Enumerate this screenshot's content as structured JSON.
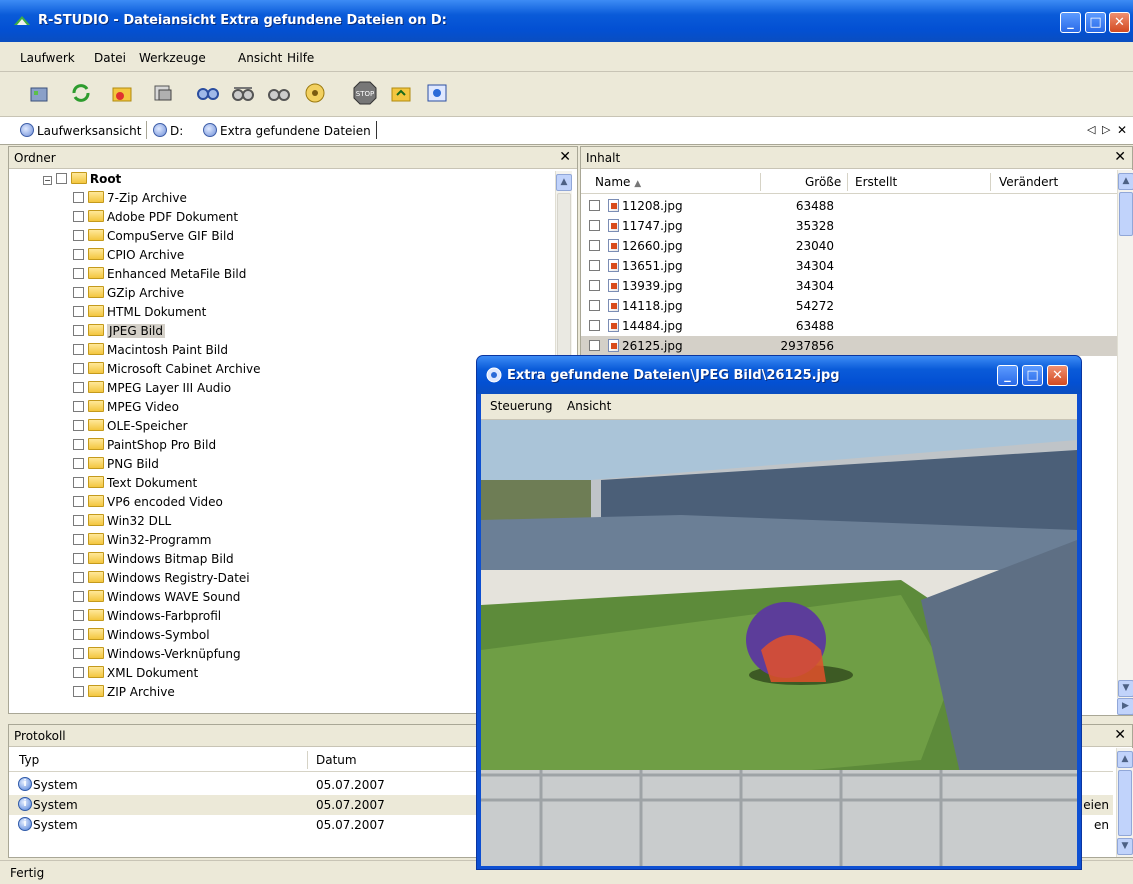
{
  "window": {
    "title": "R-STUDIO - Dateiansicht Extra gefundene Dateien on D:"
  },
  "menu": [
    "Laufwerk",
    "Datei",
    "Werkzeuge",
    "Ansicht",
    "Hilfe"
  ],
  "tabs": {
    "drive_view": "Laufwerksansicht",
    "drive": "D:",
    "extra": "Extra gefundene Dateien"
  },
  "folders": {
    "title": "Ordner",
    "root": "Root",
    "items": [
      "7-Zip Archive",
      "Adobe PDF Dokument",
      "CompuServe GIF Bild",
      "CPIO Archive",
      "Enhanced MetaFile Bild",
      "GZip Archive",
      "HTML Dokument",
      "JPEG Bild",
      "Macintosh Paint Bild",
      "Microsoft Cabinet Archive",
      "MPEG Layer III Audio",
      "MPEG Video",
      "OLE-Speicher",
      "PaintShop Pro Bild",
      "PNG Bild",
      "Text Dokument",
      "VP6 encoded Video",
      "Win32 DLL",
      "Win32-Programm",
      "Windows Bitmap Bild",
      "Windows Registry-Datei",
      "Windows WAVE Sound",
      "Windows-Farbprofil",
      "Windows-Symbol",
      "Windows-Verknüpfung",
      "XML Dokument",
      "ZIP Archive"
    ],
    "selected": "JPEG Bild"
  },
  "content": {
    "title": "Inhalt",
    "columns": {
      "name": "Name",
      "size": "Größe",
      "created": "Erstellt",
      "modified": "Verändert"
    },
    "files": [
      {
        "name": "11208.jpg",
        "size": "63488"
      },
      {
        "name": "11747.jpg",
        "size": "35328"
      },
      {
        "name": "12660.jpg",
        "size": "23040"
      },
      {
        "name": "13651.jpg",
        "size": "34304"
      },
      {
        "name": "13939.jpg",
        "size": "34304"
      },
      {
        "name": "14118.jpg",
        "size": "54272"
      },
      {
        "name": "14484.jpg",
        "size": "63488"
      },
      {
        "name": "26125.jpg",
        "size": "2937856"
      }
    ]
  },
  "log": {
    "title": "Protokoll",
    "columns": {
      "type": "Typ",
      "date": "Datum"
    },
    "rows": [
      {
        "type": "System",
        "date": "05.07.2007",
        "tail": ""
      },
      {
        "type": "System",
        "date": "05.07.2007",
        "tail": "eien"
      },
      {
        "type": "System",
        "date": "05.07.2007",
        "tail": "en"
      }
    ]
  },
  "status": "Fertig",
  "viewer": {
    "title": "Extra gefundene Dateien\\JPEG Bild\\26125.jpg",
    "menu": [
      "Steuerung",
      "Ansicht"
    ]
  }
}
